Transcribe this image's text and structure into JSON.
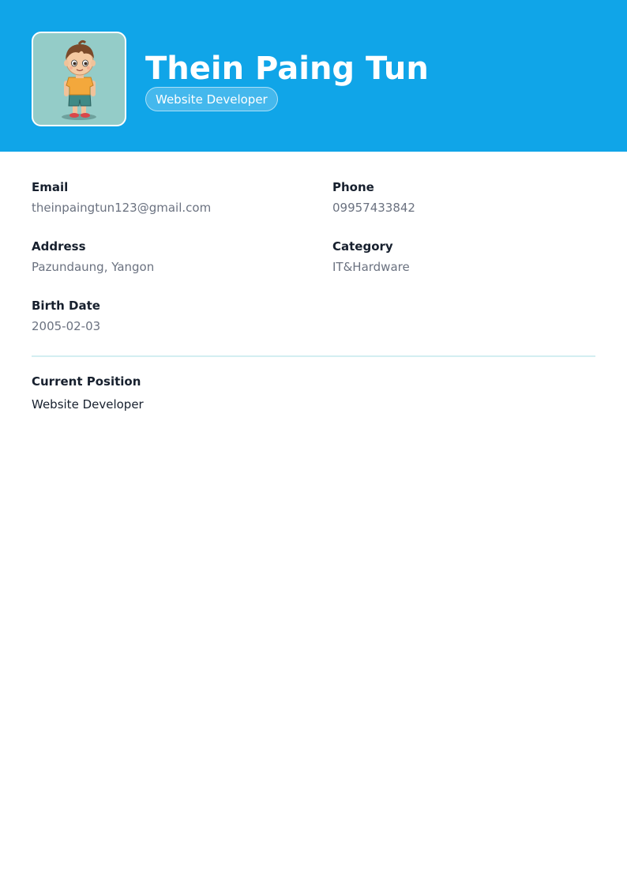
{
  "profile": {
    "name": "Thein Paing Tun",
    "title_badge": "Website Developer",
    "avatar_icon": "cartoon-boy-avatar"
  },
  "fields": {
    "email": {
      "label": "Email",
      "value": "theinpaingtun123@gmail.com"
    },
    "phone": {
      "label": "Phone",
      "value": "09957433842"
    },
    "address": {
      "label": "Address",
      "value": "Pazundaung, Yangon"
    },
    "category": {
      "label": "Category",
      "value": "IT&Hardware"
    },
    "birth_date": {
      "label": "Birth Date",
      "value": "2005-02-03"
    }
  },
  "current_position": {
    "label": "Current Position",
    "value": "Website Developer"
  },
  "colors": {
    "header_bg": "#10a5e8",
    "avatar_bg": "#94ccc8",
    "divider": "#d3eef1",
    "label_text": "#17202e",
    "value_text": "#6b7280"
  }
}
